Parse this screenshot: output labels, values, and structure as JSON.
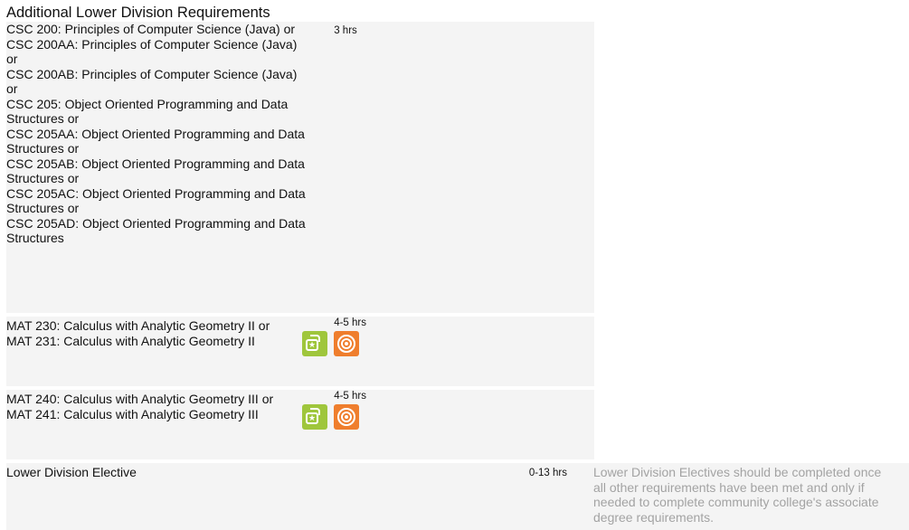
{
  "section": {
    "title": "Additional Lower Division Requirements"
  },
  "rows": [
    {
      "courses": [
        "CSC 200: Principles of Computer Science (Java) or",
        "CSC 200AA: Principles of Computer Science (Java) or",
        "CSC 200AB: Principles of Computer Science (Java) or",
        "CSC 205: Object Oriented Programming and Data Structures or",
        "CSC 205AA: Object Oriented Programming and Data Structures or",
        "CSC 205AB: Object Oriented Programming and Data Structures or",
        "CSC 205AC: Object Oriented Programming and Data Structures or",
        "CSC 205AD: Object Oriented Programming and Data Structures"
      ],
      "hours": "3 hrs"
    },
    {
      "courses": [
        "MAT 230: Calculus with Analytic Geometry II or",
        "MAT 231: Calculus with Analytic Geometry II"
      ],
      "hours": "4-5 hrs",
      "icons": [
        "general-education-badge-icon",
        "target-badge-icon"
      ]
    },
    {
      "courses": [
        "MAT 240: Calculus with Analytic Geometry III or",
        "MAT 241: Calculus with Analytic Geometry III"
      ],
      "hours": "4-5 hrs",
      "icons": [
        "general-education-badge-icon",
        "target-badge-icon"
      ]
    },
    {
      "courses": [
        "Lower Division Elective"
      ],
      "hours": "0-13 hrs",
      "note": "Lower Division Electives should be completed once all other requirements have been met and only if needed to complete community college's associate degree requirements."
    }
  ],
  "colors": {
    "row_background": "#f4f4f4",
    "note_text": "#a3a3a3",
    "badge_green": "#9fc63c",
    "badge_orange": "#ef7e2d"
  }
}
